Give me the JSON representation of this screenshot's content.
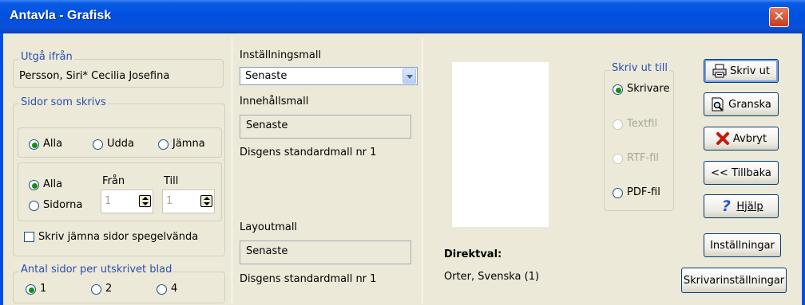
{
  "window": {
    "title": "Antavla - Grafisk",
    "close_label": "✕"
  },
  "origin": {
    "label": "Utgå ifrån",
    "value": "Persson, Siri* Cecilia Josefina"
  },
  "pages": {
    "label": "Sidor som skrivs",
    "filter": {
      "all": "Alla",
      "odd": "Udda",
      "even": "Jämna"
    },
    "range": {
      "all": "Alla",
      "pages": "Sidorna",
      "from_label": "Från",
      "to_label": "Till",
      "from_value": "1",
      "to_value": "1"
    },
    "mirror_label": "Skriv jämna sidor spegelvända"
  },
  "per_sheet": {
    "label": "Antal sidor per utskrivet blad",
    "opt1": "1",
    "opt2": "2",
    "opt4": "4"
  },
  "templates": {
    "settings_label": "Inställningsmall",
    "settings_value": "Senaste",
    "content_label": "Innehållsmall",
    "content_value": "Senaste",
    "content_desc": "Disgens standardmall nr 1",
    "layout_label": "Layoutmall",
    "layout_value": "Senaste",
    "layout_desc": "Disgens standardmall nr 1"
  },
  "direct": {
    "label": "Direktval:",
    "value": "Orter, Svenska (1)"
  },
  "output": {
    "label": "Skriv ut till",
    "printer": "Skrivare",
    "textfile": "Textfil",
    "rtf": "RTF-fil",
    "pdf": "PDF-fil"
  },
  "buttons": {
    "print": "Skriv ut",
    "preview": "Granska",
    "cancel": "Avbryt",
    "back": "<< Tillbaka",
    "help": "Hjälp",
    "settings": "Inställningar",
    "printer_settings": "Skrivarinställningar"
  }
}
